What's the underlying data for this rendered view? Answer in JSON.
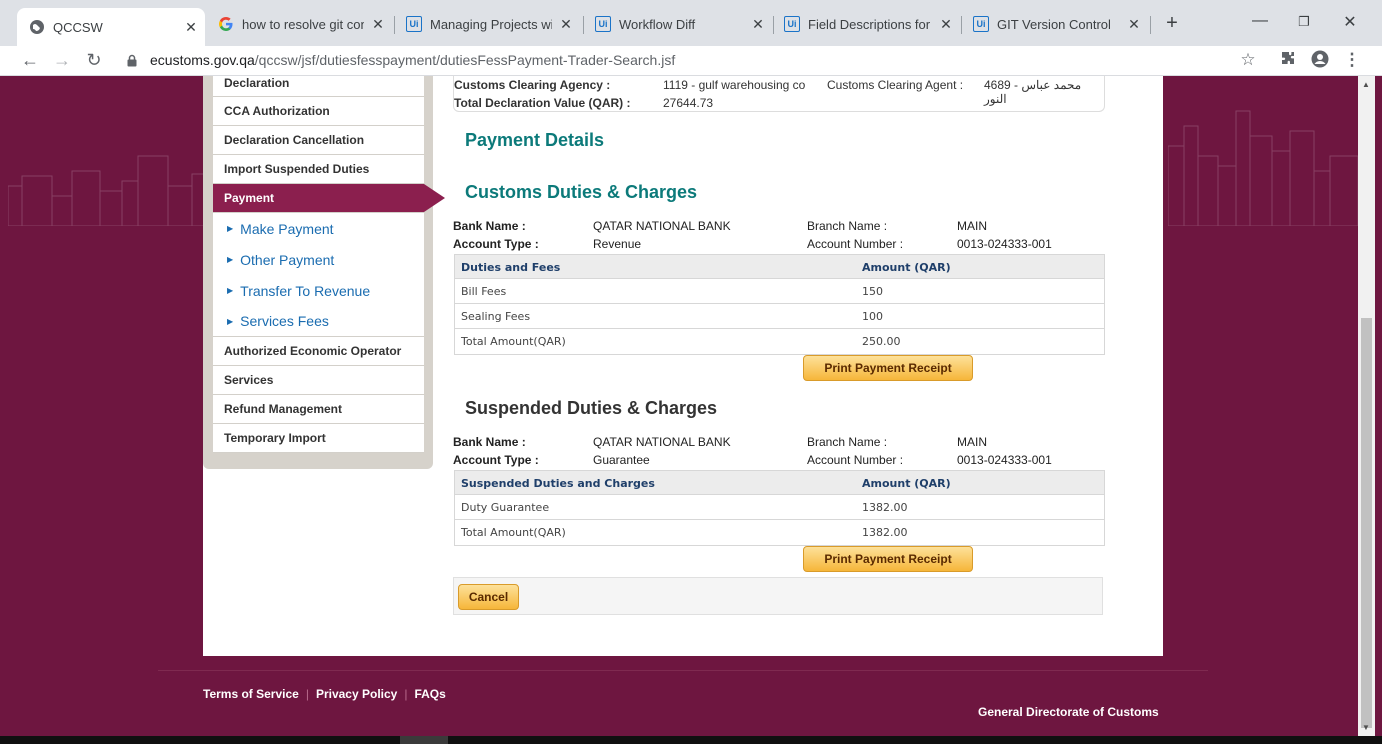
{
  "browser": {
    "tabs": [
      {
        "title": "QCCSW",
        "icon": "globe-icon"
      },
      {
        "title": "how to resolve git confl",
        "icon": "google-icon"
      },
      {
        "title": "Managing Projects with",
        "icon": "uipath-icon"
      },
      {
        "title": "Workflow Diff",
        "icon": "uipath-icon"
      },
      {
        "title": "Field Descriptions for G",
        "icon": "uipath-icon"
      },
      {
        "title": "GIT Version Control",
        "icon": "uipath-icon"
      }
    ],
    "url_host": "ecustoms.gov.qa",
    "url_path": "/qccsw/jsf/dutiesfesspayment/dutiesFessPayment-Trader-Search.jsf"
  },
  "sidebar": {
    "items_top": [
      "Declaration",
      "CCA Authorization",
      "Declaration Cancellation",
      "Import Suspended Duties"
    ],
    "active": "Payment",
    "sub_items": [
      "Make Payment",
      "Other Payment",
      "Transfer To Revenue",
      "Services Fees"
    ],
    "items_bottom": [
      "Authorized Economic Operator",
      "Services",
      "Refund Management",
      "Temporary Import"
    ]
  },
  "info": {
    "agency_label": "Customs Clearing Agency :",
    "agency_value": "1119 - gulf warehousing co",
    "agent_label": "Customs Clearing Agent :",
    "agent_value": "4689 - محمد عباس النور",
    "total_label": "Total Declaration Value (QAR) :",
    "total_value": "27644.73"
  },
  "payment_details_title": "Payment Details",
  "customs": {
    "title": "Customs Duties & Charges",
    "bank_name_label": "Bank Name :",
    "bank_name": "QATAR NATIONAL BANK",
    "branch_label": "Branch Name :",
    "branch": "MAIN",
    "account_type_label": "Account Type :",
    "account_type": "Revenue",
    "account_number_label": "Account Number :",
    "account_number": "0013-024333-001",
    "col1": "Duties and Fees",
    "col2": "Amount (QAR)",
    "rows": [
      {
        "name": "Bill Fees",
        "amount": "150"
      },
      {
        "name": "Sealing Fees",
        "amount": "100"
      },
      {
        "name": "Total Amount(QAR)",
        "amount": "250.00"
      }
    ],
    "print_label": "Print Payment Receipt"
  },
  "suspended": {
    "title": "Suspended Duties & Charges",
    "bank_name_label": "Bank Name :",
    "bank_name": "QATAR NATIONAL BANK",
    "branch_label": "Branch Name :",
    "branch": "MAIN",
    "account_type_label": "Account Type :",
    "account_type": "Guarantee",
    "account_number_label": "Account Number :",
    "account_number": "0013-024333-001",
    "col1": "Suspended Duties and Charges",
    "col2": "Amount (QAR)",
    "rows": [
      {
        "name": "Duty Guarantee",
        "amount": "1382.00"
      },
      {
        "name": "Total Amount(QAR)",
        "amount": "1382.00"
      }
    ],
    "print_label": "Print Payment Receipt"
  },
  "cancel_label": "Cancel",
  "footer": {
    "links": [
      "Terms of Service",
      "Privacy Policy",
      "FAQs"
    ],
    "org": "General Directorate of Customs"
  }
}
